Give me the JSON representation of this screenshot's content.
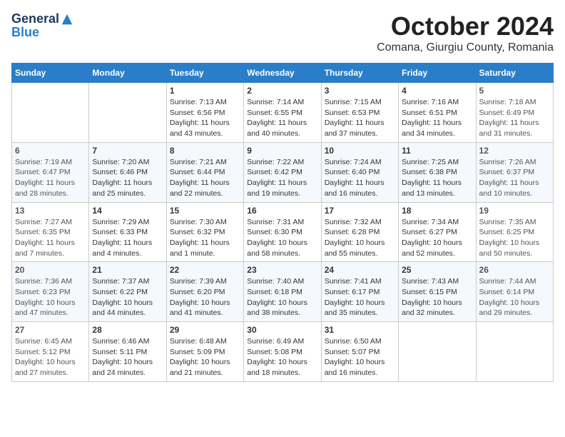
{
  "logo": {
    "general": "General",
    "blue": "Blue"
  },
  "title": {
    "month": "October 2024",
    "location": "Comana, Giurgiu County, Romania"
  },
  "headers": [
    "Sunday",
    "Monday",
    "Tuesday",
    "Wednesday",
    "Thursday",
    "Friday",
    "Saturday"
  ],
  "weeks": [
    [
      {
        "day": "",
        "info": ""
      },
      {
        "day": "",
        "info": ""
      },
      {
        "day": "1",
        "info": "Sunrise: 7:13 AM\nSunset: 6:56 PM\nDaylight: 11 hours and 43 minutes."
      },
      {
        "day": "2",
        "info": "Sunrise: 7:14 AM\nSunset: 6:55 PM\nDaylight: 11 hours and 40 minutes."
      },
      {
        "day": "3",
        "info": "Sunrise: 7:15 AM\nSunset: 6:53 PM\nDaylight: 11 hours and 37 minutes."
      },
      {
        "day": "4",
        "info": "Sunrise: 7:16 AM\nSunset: 6:51 PM\nDaylight: 11 hours and 34 minutes."
      },
      {
        "day": "5",
        "info": "Sunrise: 7:18 AM\nSunset: 6:49 PM\nDaylight: 11 hours and 31 minutes."
      }
    ],
    [
      {
        "day": "6",
        "info": "Sunrise: 7:19 AM\nSunset: 6:47 PM\nDaylight: 11 hours and 28 minutes."
      },
      {
        "day": "7",
        "info": "Sunrise: 7:20 AM\nSunset: 6:46 PM\nDaylight: 11 hours and 25 minutes."
      },
      {
        "day": "8",
        "info": "Sunrise: 7:21 AM\nSunset: 6:44 PM\nDaylight: 11 hours and 22 minutes."
      },
      {
        "day": "9",
        "info": "Sunrise: 7:22 AM\nSunset: 6:42 PM\nDaylight: 11 hours and 19 minutes."
      },
      {
        "day": "10",
        "info": "Sunrise: 7:24 AM\nSunset: 6:40 PM\nDaylight: 11 hours and 16 minutes."
      },
      {
        "day": "11",
        "info": "Sunrise: 7:25 AM\nSunset: 6:38 PM\nDaylight: 11 hours and 13 minutes."
      },
      {
        "day": "12",
        "info": "Sunrise: 7:26 AM\nSunset: 6:37 PM\nDaylight: 11 hours and 10 minutes."
      }
    ],
    [
      {
        "day": "13",
        "info": "Sunrise: 7:27 AM\nSunset: 6:35 PM\nDaylight: 11 hours and 7 minutes."
      },
      {
        "day": "14",
        "info": "Sunrise: 7:29 AM\nSunset: 6:33 PM\nDaylight: 11 hours and 4 minutes."
      },
      {
        "day": "15",
        "info": "Sunrise: 7:30 AM\nSunset: 6:32 PM\nDaylight: 11 hours and 1 minute."
      },
      {
        "day": "16",
        "info": "Sunrise: 7:31 AM\nSunset: 6:30 PM\nDaylight: 10 hours and 58 minutes."
      },
      {
        "day": "17",
        "info": "Sunrise: 7:32 AM\nSunset: 6:28 PM\nDaylight: 10 hours and 55 minutes."
      },
      {
        "day": "18",
        "info": "Sunrise: 7:34 AM\nSunset: 6:27 PM\nDaylight: 10 hours and 52 minutes."
      },
      {
        "day": "19",
        "info": "Sunrise: 7:35 AM\nSunset: 6:25 PM\nDaylight: 10 hours and 50 minutes."
      }
    ],
    [
      {
        "day": "20",
        "info": "Sunrise: 7:36 AM\nSunset: 6:23 PM\nDaylight: 10 hours and 47 minutes."
      },
      {
        "day": "21",
        "info": "Sunrise: 7:37 AM\nSunset: 6:22 PM\nDaylight: 10 hours and 44 minutes."
      },
      {
        "day": "22",
        "info": "Sunrise: 7:39 AM\nSunset: 6:20 PM\nDaylight: 10 hours and 41 minutes."
      },
      {
        "day": "23",
        "info": "Sunrise: 7:40 AM\nSunset: 6:18 PM\nDaylight: 10 hours and 38 minutes."
      },
      {
        "day": "24",
        "info": "Sunrise: 7:41 AM\nSunset: 6:17 PM\nDaylight: 10 hours and 35 minutes."
      },
      {
        "day": "25",
        "info": "Sunrise: 7:43 AM\nSunset: 6:15 PM\nDaylight: 10 hours and 32 minutes."
      },
      {
        "day": "26",
        "info": "Sunrise: 7:44 AM\nSunset: 6:14 PM\nDaylight: 10 hours and 29 minutes."
      }
    ],
    [
      {
        "day": "27",
        "info": "Sunrise: 6:45 AM\nSunset: 5:12 PM\nDaylight: 10 hours and 27 minutes."
      },
      {
        "day": "28",
        "info": "Sunrise: 6:46 AM\nSunset: 5:11 PM\nDaylight: 10 hours and 24 minutes."
      },
      {
        "day": "29",
        "info": "Sunrise: 6:48 AM\nSunset: 5:09 PM\nDaylight: 10 hours and 21 minutes."
      },
      {
        "day": "30",
        "info": "Sunrise: 6:49 AM\nSunset: 5:08 PM\nDaylight: 10 hours and 18 minutes."
      },
      {
        "day": "31",
        "info": "Sunrise: 6:50 AM\nSunset: 5:07 PM\nDaylight: 10 hours and 16 minutes."
      },
      {
        "day": "",
        "info": ""
      },
      {
        "day": "",
        "info": ""
      }
    ]
  ]
}
